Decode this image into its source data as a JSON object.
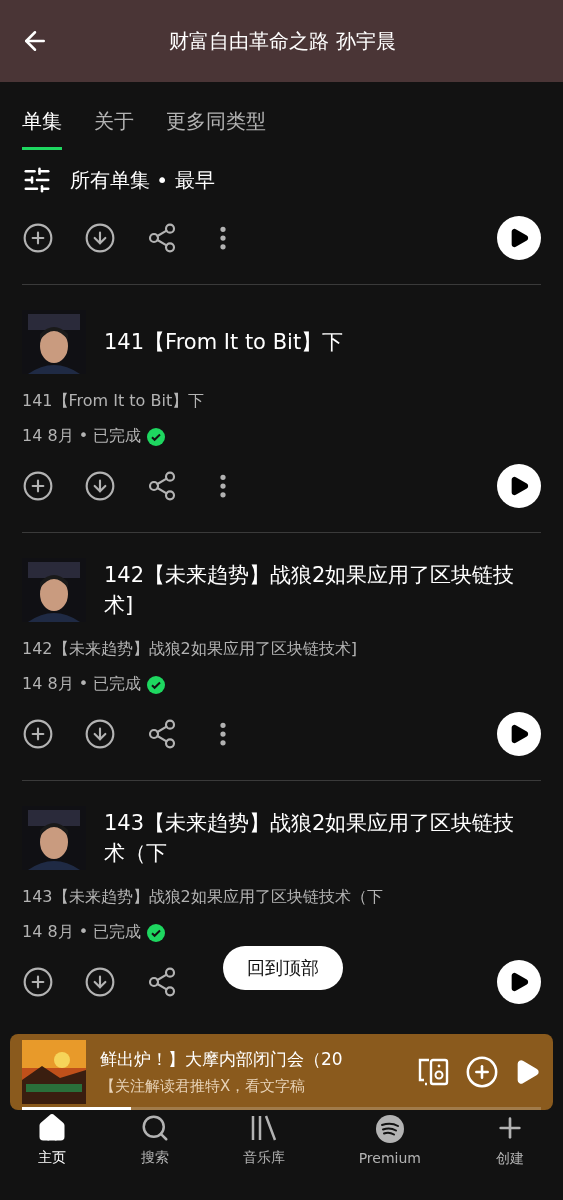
{
  "header": {
    "title": "财富自由革命之路 孙宇晨"
  },
  "tabs": [
    {
      "label": "单集",
      "selected": true
    },
    {
      "label": "关于",
      "selected": false
    },
    {
      "label": "更多同类型",
      "selected": false
    }
  ],
  "filter": {
    "label": "所有单集 • 最早"
  },
  "episodes": [
    {
      "title": "141【From It to Bit】下",
      "description": "141【From It to Bit】下",
      "date": "14 8月 • 已完成",
      "completed": true
    },
    {
      "title": "142【未来趋势】战狼2如果应用了区块链技术]",
      "description": "142【未来趋势】战狼2如果应用了区块链技术]",
      "date": "14 8月 • 已完成",
      "completed": true
    },
    {
      "title": "143【未来趋势】战狼2如果应用了区块链技术（下",
      "description": "143【未来趋势】战狼2如果应用了区块链技术（下",
      "date": "14 8月 • 已完成",
      "completed": true
    }
  ],
  "back_to_top": "回到顶部",
  "mini_player": {
    "title": "鲜出炉！】大摩内部闭门会（20",
    "subtitle": "【关注解读君推特X，看文字稿",
    "level": 0.21
  },
  "nav": [
    {
      "label": "主页",
      "kind": "home",
      "selected": true
    },
    {
      "label": "搜索",
      "kind": "search",
      "selected": false
    },
    {
      "label": "音乐库",
      "kind": "library",
      "selected": false
    },
    {
      "label": "Premium",
      "kind": "premium",
      "selected": false
    },
    {
      "label": "创建",
      "kind": "create",
      "selected": false
    }
  ]
}
